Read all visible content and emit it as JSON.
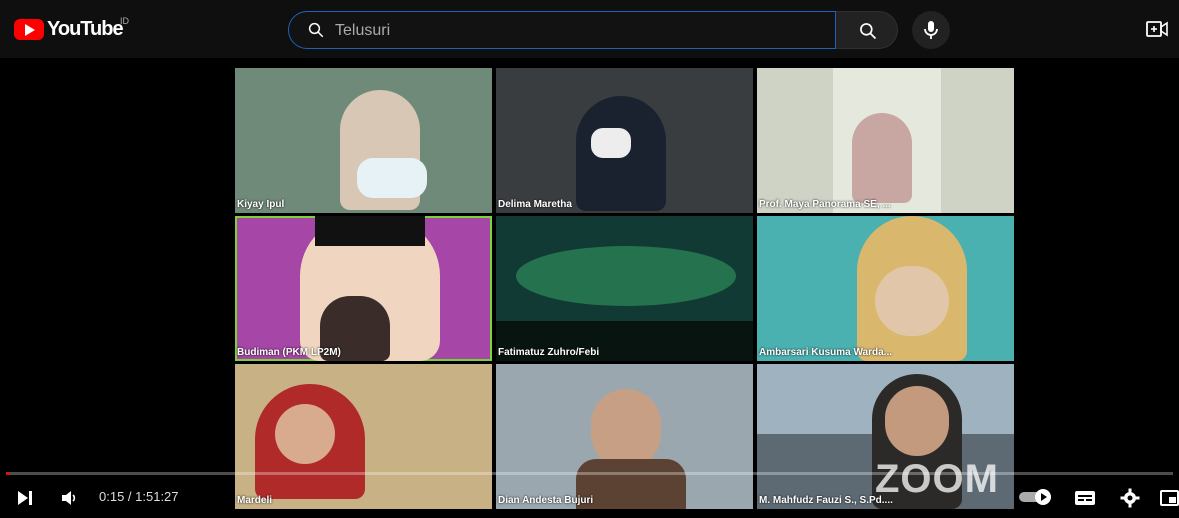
{
  "header": {
    "logo_text": "YouTube",
    "country_code": "ID",
    "search_placeholder": "Telusuri"
  },
  "participants": [
    {
      "name": "Kiyay Ipul",
      "bg": "#6f8a78"
    },
    {
      "name": "Delima Maretha",
      "bg": "#3a3d40"
    },
    {
      "name": "Prof. Maya Panorama SE, ...",
      "bg": "#cfd3c6"
    },
    {
      "name": "Budiman (PKM LP2M)",
      "bg": "#a646a6"
    },
    {
      "name": "Fatimatuz Zuhro/Febi",
      "bg": "#123a34"
    },
    {
      "name": "Ambarsari Kusuma Warda...",
      "bg": "#4ab0b0"
    },
    {
      "name": "Mardeli",
      "bg": "#c7b185"
    },
    {
      "name": "Dian Andesta Bujuri",
      "bg": "#9aa7ae"
    },
    {
      "name": "M. Mahfudz Fauzi S., S.Pd....",
      "bg": "#5e6a73"
    }
  ],
  "active_speaker_index": 3,
  "player": {
    "current_time": "0:15",
    "duration": "1:51:27",
    "time_display": "0:15 / 1:51:27",
    "progress_fraction": 0.0022,
    "watermark": "ZOOM"
  }
}
